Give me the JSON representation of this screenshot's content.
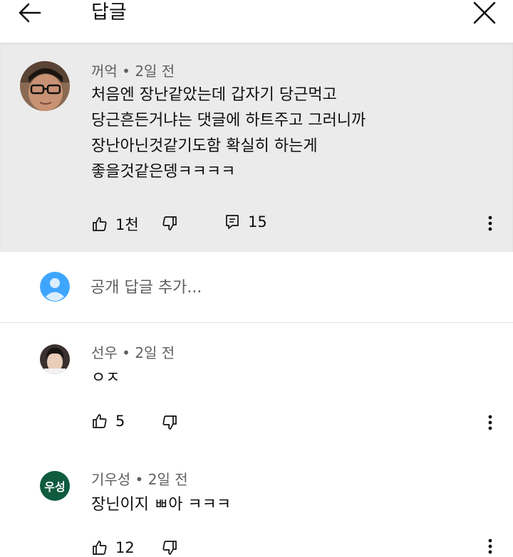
{
  "header": {
    "title": "답글"
  },
  "main_comment": {
    "author": "꺼억",
    "time": "2일 전",
    "lines": [
      "처음엔 장난같았는데 갑자기 당근먹고",
      "당근흔든거냐는 댓글에 하트주고 그러니까",
      "장난아닌것같기도함 확실히 하는게",
      "좋을것같은뎅ㅋㅋㅋㅋ"
    ],
    "likes": "1천",
    "replies": "15"
  },
  "reply_input": {
    "placeholder": "공개 답글 추가..."
  },
  "replies": [
    {
      "author": "선우",
      "time": "2일 전",
      "text": "ㅇㅈ",
      "likes": "5"
    },
    {
      "author": "기우성",
      "time": "2일 전",
      "text": "장닌이지 ㅃ아 ㅋㅋㅋ",
      "likes": "12",
      "avatar_text": "우성",
      "avatar_color": "#0f5b3f"
    }
  ],
  "colors": {
    "highlight_bg": "#ebebeb",
    "meta_text": "#606060",
    "avatar_default": "#3ea6ff"
  }
}
